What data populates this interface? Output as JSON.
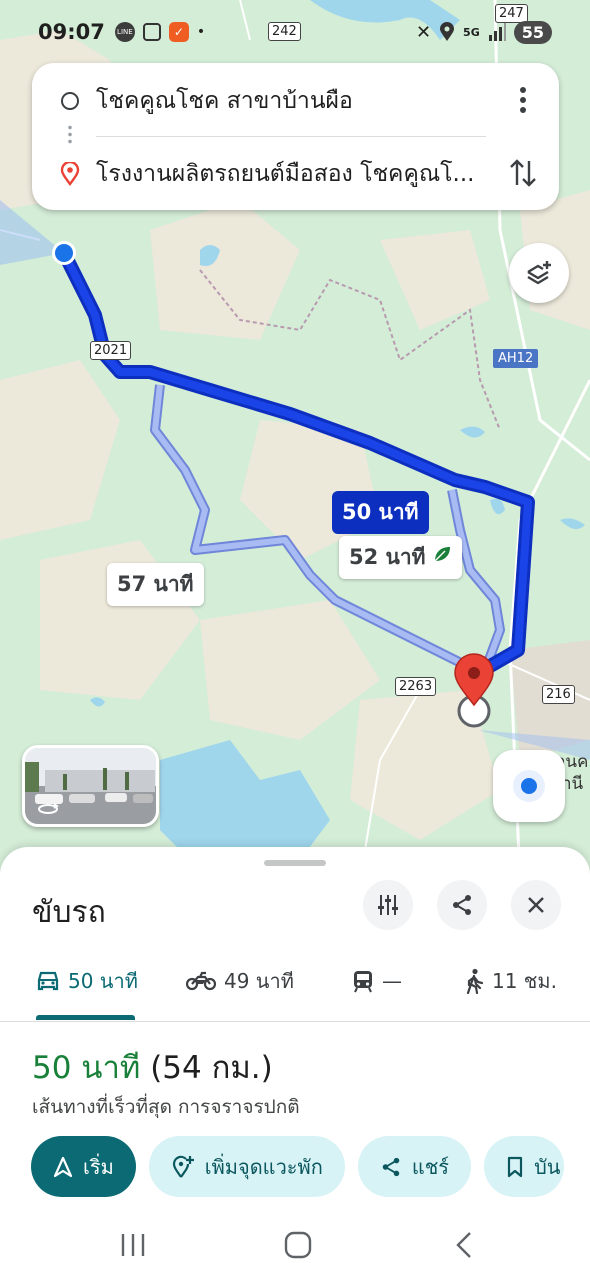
{
  "status": {
    "time": "09:07",
    "battery": "55",
    "network": "5G"
  },
  "search": {
    "origin": "โชคคูณโชค สาขาบ้านผือ",
    "destination": "โรงงานผลิตรถยนต์มือสอง โชคคูณโ..."
  },
  "map": {
    "route_main_label": "50 นาที",
    "route_alt1_label": "52 นาที",
    "route_alt2_label": "57 นาที",
    "road_2021": "2021",
    "road_242": "242",
    "road_247": "247",
    "road_2263": "2263",
    "road_216": "216",
    "road_ah12": "AH12",
    "place_partial_1": "ลนค",
    "place_partial_2": "านี",
    "colors": {
      "route_main": "#1a43e8",
      "route_alt": "#8fa6ef",
      "water": "#9fd6ec",
      "land": "#d3ecd6",
      "urban": "#e8e4d8"
    }
  },
  "sheet": {
    "title": "ขับรถ",
    "modes": [
      {
        "icon": "car-icon",
        "label": "50 นาที"
      },
      {
        "icon": "motorcycle-icon",
        "label": "49 นาที"
      },
      {
        "icon": "transit-icon",
        "label": "—"
      },
      {
        "icon": "walk-icon",
        "label": "11 ชม."
      }
    ],
    "summary_time": "50 นาที",
    "summary_dist": "(54 กม.)",
    "subline": "เส้นทางที่เร็วที่สุด การจราจรปกติ",
    "actions": {
      "start": "เริ่ม",
      "add_stop": "เพิ่มจุดแวะพัก",
      "share": "แชร์",
      "save": "บัน"
    },
    "accent": "#0b6a73"
  }
}
